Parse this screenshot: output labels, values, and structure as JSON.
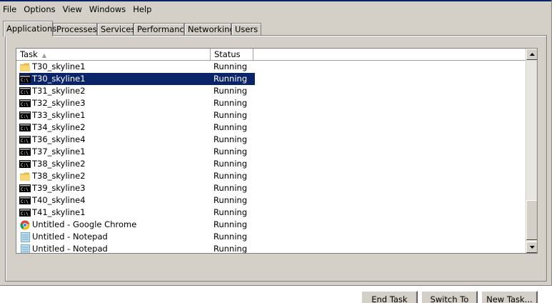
{
  "menu": [
    "File",
    "Options",
    "View",
    "Windows",
    "Help"
  ],
  "tabs": [
    "Applications",
    "Processes",
    "Services",
    "Performance",
    "Networking",
    "Users"
  ],
  "active_tab": "Applications",
  "columns": {
    "task": "Task",
    "status": "Status"
  },
  "rows": [
    {
      "task": "T30_skyline1",
      "status": "Running",
      "icon": "folder-icon"
    },
    {
      "task": "T30_skyline1",
      "status": "Running",
      "icon": "console-icon",
      "selected": true
    },
    {
      "task": "T31_skyline2",
      "status": "Running",
      "icon": "console-icon"
    },
    {
      "task": "T32_skyline3",
      "status": "Running",
      "icon": "console-icon"
    },
    {
      "task": "T33_skyline1",
      "status": "Running",
      "icon": "console-icon"
    },
    {
      "task": "T34_skyline2",
      "status": "Running",
      "icon": "console-icon"
    },
    {
      "task": "T36_skyline4",
      "status": "Running",
      "icon": "console-icon"
    },
    {
      "task": "T37_skyline1",
      "status": "Running",
      "icon": "console-icon"
    },
    {
      "task": "T38_skyline2",
      "status": "Running",
      "icon": "console-icon"
    },
    {
      "task": "T38_skyline2",
      "status": "Running",
      "icon": "folder-icon"
    },
    {
      "task": "T39_skyline3",
      "status": "Running",
      "icon": "console-icon"
    },
    {
      "task": "T40_skyline4",
      "status": "Running",
      "icon": "console-icon"
    },
    {
      "task": "T41_skyline1",
      "status": "Running",
      "icon": "console-icon"
    },
    {
      "task": "Untitled - Google Chrome",
      "status": "Running",
      "icon": "chrome-icon"
    },
    {
      "task": "Untitled - Notepad",
      "status": "Running",
      "icon": "notepad-icon"
    },
    {
      "task": "Untitled - Notepad",
      "status": "Running",
      "icon": "notepad-icon"
    }
  ],
  "buttons": {
    "end_task": "End Task",
    "switch_to": "Switch To",
    "new_task": "New Task..."
  },
  "colors": {
    "selection": "#0a246a",
    "chrome_face": "#d4d0c8"
  }
}
